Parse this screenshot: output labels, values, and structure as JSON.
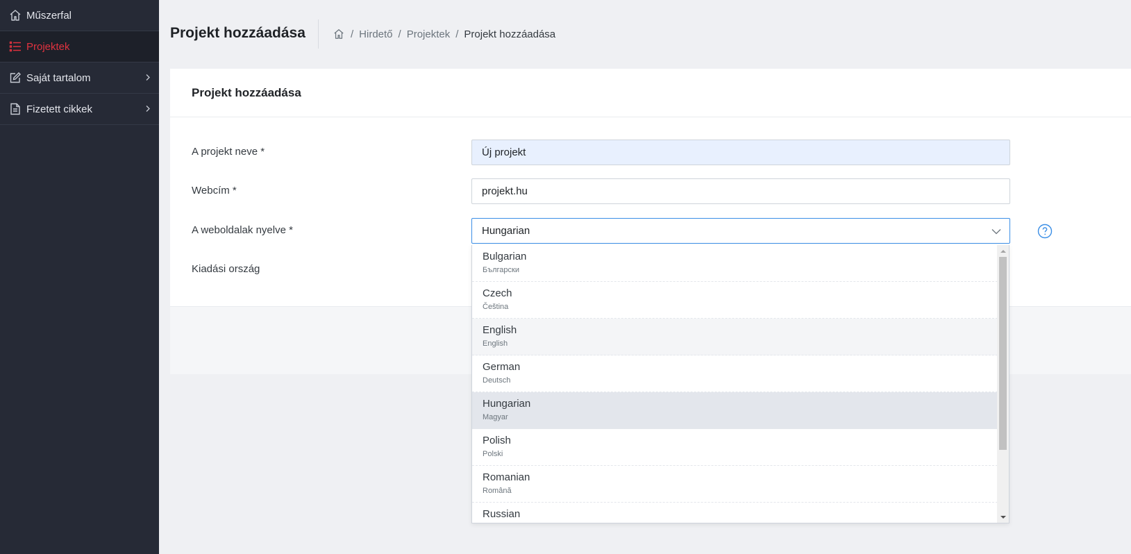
{
  "sidebar": {
    "items": [
      {
        "label": "Műszerfal",
        "icon": "home-icon"
      },
      {
        "label": "Projektek",
        "icon": "list-icon",
        "active": true
      },
      {
        "label": "Saját tartalom",
        "icon": "edit-icon",
        "has_children": true
      },
      {
        "label": "Fizetett cikkek",
        "icon": "document-icon",
        "has_children": true
      }
    ]
  },
  "header": {
    "title": "Projekt hozzáadása",
    "breadcrumb": [
      "Hirdető",
      "Projektek",
      "Projekt hozzáadása"
    ]
  },
  "card": {
    "title": "Projekt hozzáadása"
  },
  "form": {
    "project_name_label": "A projekt neve *",
    "project_name_value": "Új projekt",
    "url_label": "Webcím *",
    "url_value": "projekt.hu",
    "language_label": "A weboldalak nyelve *",
    "language_value": "Hungarian",
    "country_label": "Kiadási ország"
  },
  "dropdown": {
    "options": [
      {
        "name": "Bulgarian",
        "native": "Български"
      },
      {
        "name": "Czech",
        "native": "Čeština"
      },
      {
        "name": "English",
        "native": "English"
      },
      {
        "name": "German",
        "native": "Deutsch"
      },
      {
        "name": "Hungarian",
        "native": "Magyar"
      },
      {
        "name": "Polish",
        "native": "Polski"
      },
      {
        "name": "Romanian",
        "native": "Română"
      },
      {
        "name": "Russian",
        "native": ""
      }
    ],
    "hovered": "English",
    "selected": "Hungarian"
  },
  "colors": {
    "sidebar_bg": "#262a36",
    "active": "#e0323f",
    "accent": "#3a8ee6"
  }
}
